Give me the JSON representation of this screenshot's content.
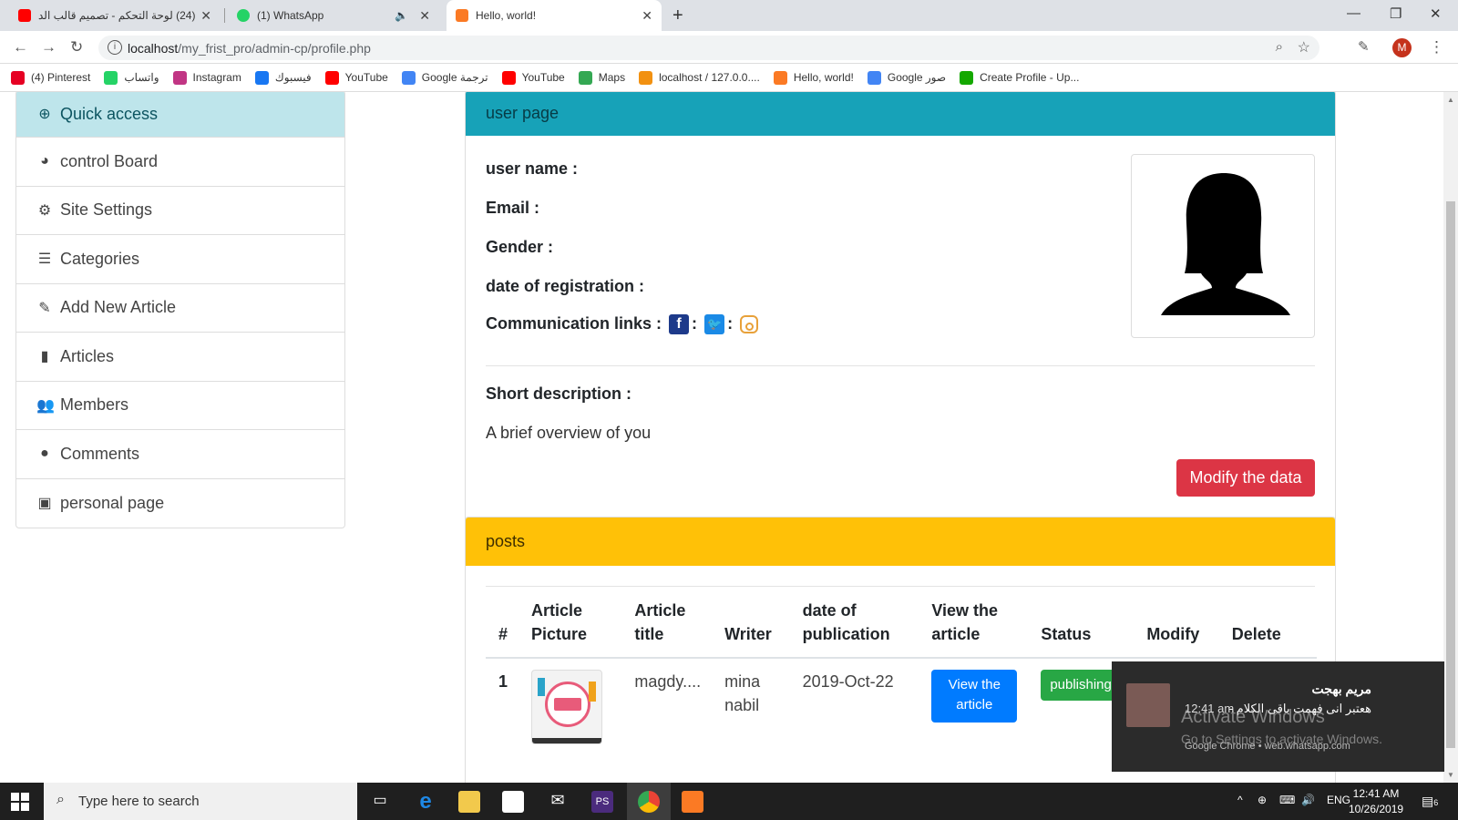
{
  "browser": {
    "tabs": [
      {
        "title": "(24) لوحة التحكم - تصميم قالب الد",
        "icon": "youtube-icon",
        "color": "#ff0000"
      },
      {
        "title": "(1) WhatsApp",
        "icon": "whatsapp-icon",
        "color": "#25d366"
      },
      {
        "title": "Hello, world!",
        "icon": "xampp-icon",
        "color": "#fb7a24"
      }
    ],
    "url_host": "localhost",
    "url_path": "/my_frist_pro/admin-cp/profile.php",
    "profile_initial": "M",
    "bookmarks": [
      {
        "label": "(4) Pinterest",
        "color": "#e60023"
      },
      {
        "label": "واتساب",
        "color": "#25d366"
      },
      {
        "label": "Instagram",
        "color": "#c13584"
      },
      {
        "label": "فيسبوك",
        "color": "#1877f2"
      },
      {
        "label": "YouTube",
        "color": "#ff0000"
      },
      {
        "label": "Google ترجمة",
        "color": "#4285f4"
      },
      {
        "label": "YouTube",
        "color": "#ff0000"
      },
      {
        "label": "Maps",
        "color": "#34a853"
      },
      {
        "label": "localhost / 127.0.0....",
        "color": "#f29111"
      },
      {
        "label": "Hello, world!",
        "color": "#fb7a24"
      },
      {
        "label": "Google صور",
        "color": "#4285f4"
      },
      {
        "label": "Create Profile - Up...",
        "color": "#14a800"
      }
    ]
  },
  "sidebar": {
    "items": [
      {
        "label": "Quick access",
        "icon": "plus-circle-icon"
      },
      {
        "label": "control Board",
        "icon": "dashboard-icon"
      },
      {
        "label": "Site Settings",
        "icon": "gear-icon"
      },
      {
        "label": "Categories",
        "icon": "list-icon"
      },
      {
        "label": "Add New Article",
        "icon": "edit-icon"
      },
      {
        "label": "Articles",
        "icon": "file-icon"
      },
      {
        "label": "Members",
        "icon": "users-icon"
      },
      {
        "label": "Comments",
        "icon": "comment-icon"
      },
      {
        "label": "personal page",
        "icon": "id-card-icon"
      }
    ]
  },
  "user_card": {
    "header": "user page",
    "username_label": "user name :",
    "email_label": "Email :",
    "gender_label": "Gender :",
    "registration_label": "date of registration :",
    "links_label": "Communication links :",
    "separator": ":",
    "short_desc_label": "Short description :",
    "short_desc": "A brief overview of you",
    "modify_button": "Modify the data"
  },
  "posts_card": {
    "header": "posts",
    "columns": [
      "#",
      "Article Picture",
      "Article title",
      "Writer",
      "date of publication",
      "View the article",
      "Status",
      "Modify",
      "Delete"
    ],
    "rows": [
      {
        "num": "1",
        "title": "magdy....",
        "writer": "mina nabil",
        "date": "2019-Oct-22",
        "view_btn": "View the article",
        "status": "publishing"
      }
    ]
  },
  "notification": {
    "name": "مريم بهجت",
    "message": "هعتبر انى فهمت باقى الكلام -",
    "time": "12:41 am",
    "source": "Google Chrome • web.whatsapp.com"
  },
  "watermark": {
    "line1": "Activate Windows",
    "line2": "Go to Settings to activate Windows."
  },
  "taskbar": {
    "search_placeholder": "Type here to search",
    "lang": "ENG",
    "time": "12:41 AM",
    "date": "10/26/2019",
    "notif_count": "6"
  },
  "colors": {
    "info": "#17a2b8",
    "warning": "#ffc107",
    "danger": "#dc3545",
    "primary": "#007bff",
    "success": "#28a745"
  }
}
